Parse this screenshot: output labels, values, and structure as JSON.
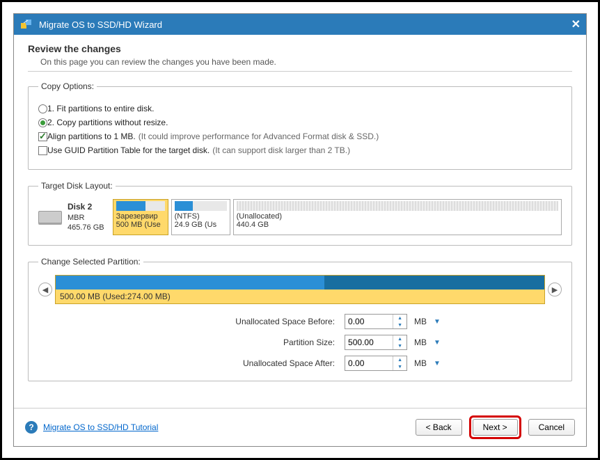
{
  "title": "Migrate OS to SSD/HD Wizard",
  "heading": "Review the changes",
  "subheading": "On this page you can review the changes you have been made.",
  "copy_options": {
    "legend": "Copy Options:",
    "opt1": "1. Fit partitions to entire disk.",
    "opt2": "2. Copy partitions without resize.",
    "align": "Align partitions to 1 MB.",
    "align_hint": "(It could improve performance for Advanced Format disk & SSD.)",
    "guid": "Use GUID Partition Table for the target disk.",
    "guid_hint": "(It can support disk larger than 2 TB.)"
  },
  "target": {
    "legend": "Target Disk Layout:",
    "disk_name": "Disk 2",
    "disk_type": "MBR",
    "disk_size": "465.76 GB",
    "p1_name": "Зарезервир",
    "p1_size": "500 MB (Use",
    "p2_name": "(NTFS)",
    "p2_size": "24.9 GB (Us",
    "p3_name": "(Unallocated)",
    "p3_size": "440.4 GB"
  },
  "selected": {
    "legend": "Change Selected Partition:",
    "text": "500.00 MB (Used:274.00 MB)"
  },
  "form": {
    "before_label": "Unallocated Space Before:",
    "before_value": "0.00",
    "size_label": "Partition Size:",
    "size_value": "500.00",
    "after_label": "Unallocated Space After:",
    "after_value": "0.00",
    "unit": "MB"
  },
  "footer": {
    "tutorial": "Migrate OS to SSD/HD Tutorial",
    "back": "< Back",
    "next": "Next >",
    "cancel": "Cancel"
  }
}
